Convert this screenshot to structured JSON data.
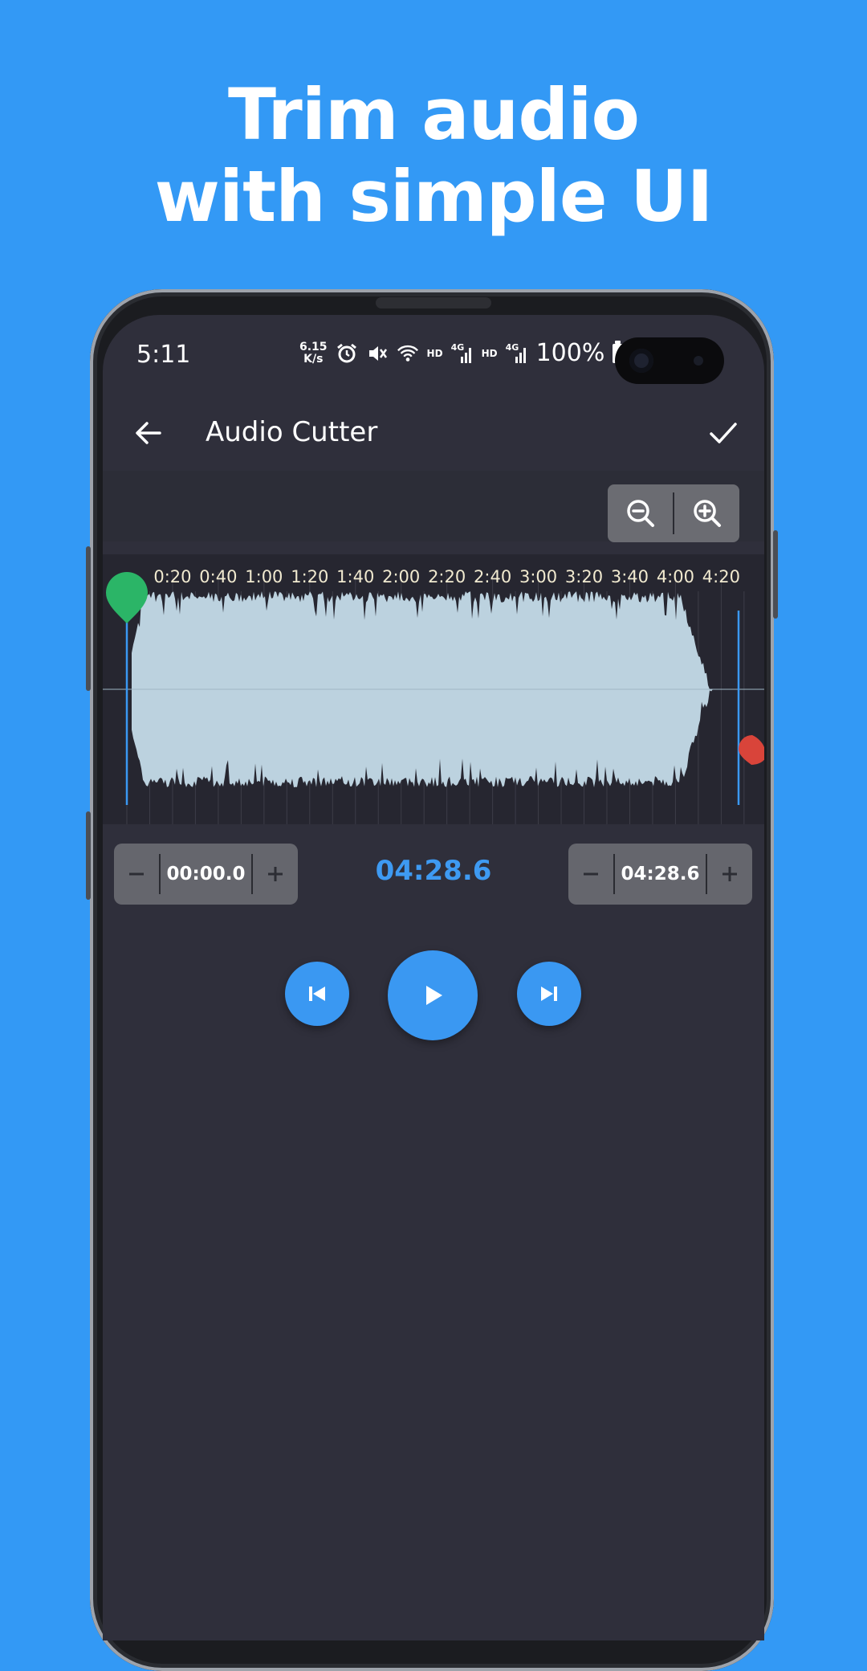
{
  "promo": {
    "line1": "Trim audio",
    "line2": "with simple UI"
  },
  "status_bar": {
    "time": "5:11",
    "net_speed_value": "6.15",
    "net_speed_unit": "K/s",
    "hd_label_1": "HD",
    "signal_label_1": "4G",
    "hd_label_2": "HD",
    "signal_label_2": "4G",
    "battery": "100%"
  },
  "app_bar": {
    "title": "Audio Cutter"
  },
  "waveform": {
    "time_labels": [
      "0:20",
      "0:40",
      "1:00",
      "1:20",
      "1:40",
      "2:00",
      "2:20",
      "2:40",
      "3:00",
      "3:20",
      "3:40",
      "4:00",
      "4:20"
    ]
  },
  "trim": {
    "start_time": "00:00.0",
    "duration": "04:28.6",
    "end_time": "04:28.6",
    "minus_label": "−",
    "plus_label": "+"
  },
  "icons": {
    "back": "arrow-left-icon",
    "confirm": "check-icon",
    "zoom_out": "zoom-out-icon",
    "zoom_in": "zoom-in-icon",
    "skip_previous": "skip-previous-icon",
    "play": "play-icon",
    "skip_next": "skip-next-icon"
  },
  "colors": {
    "page_background": "#3399f5",
    "screen_background": "#2f2f3b",
    "accent": "#3a98f2",
    "waveform": "#bcd2df",
    "start_marker": "#2bb567",
    "end_marker": "#d9443a",
    "tick_label": "#f1ead0"
  }
}
